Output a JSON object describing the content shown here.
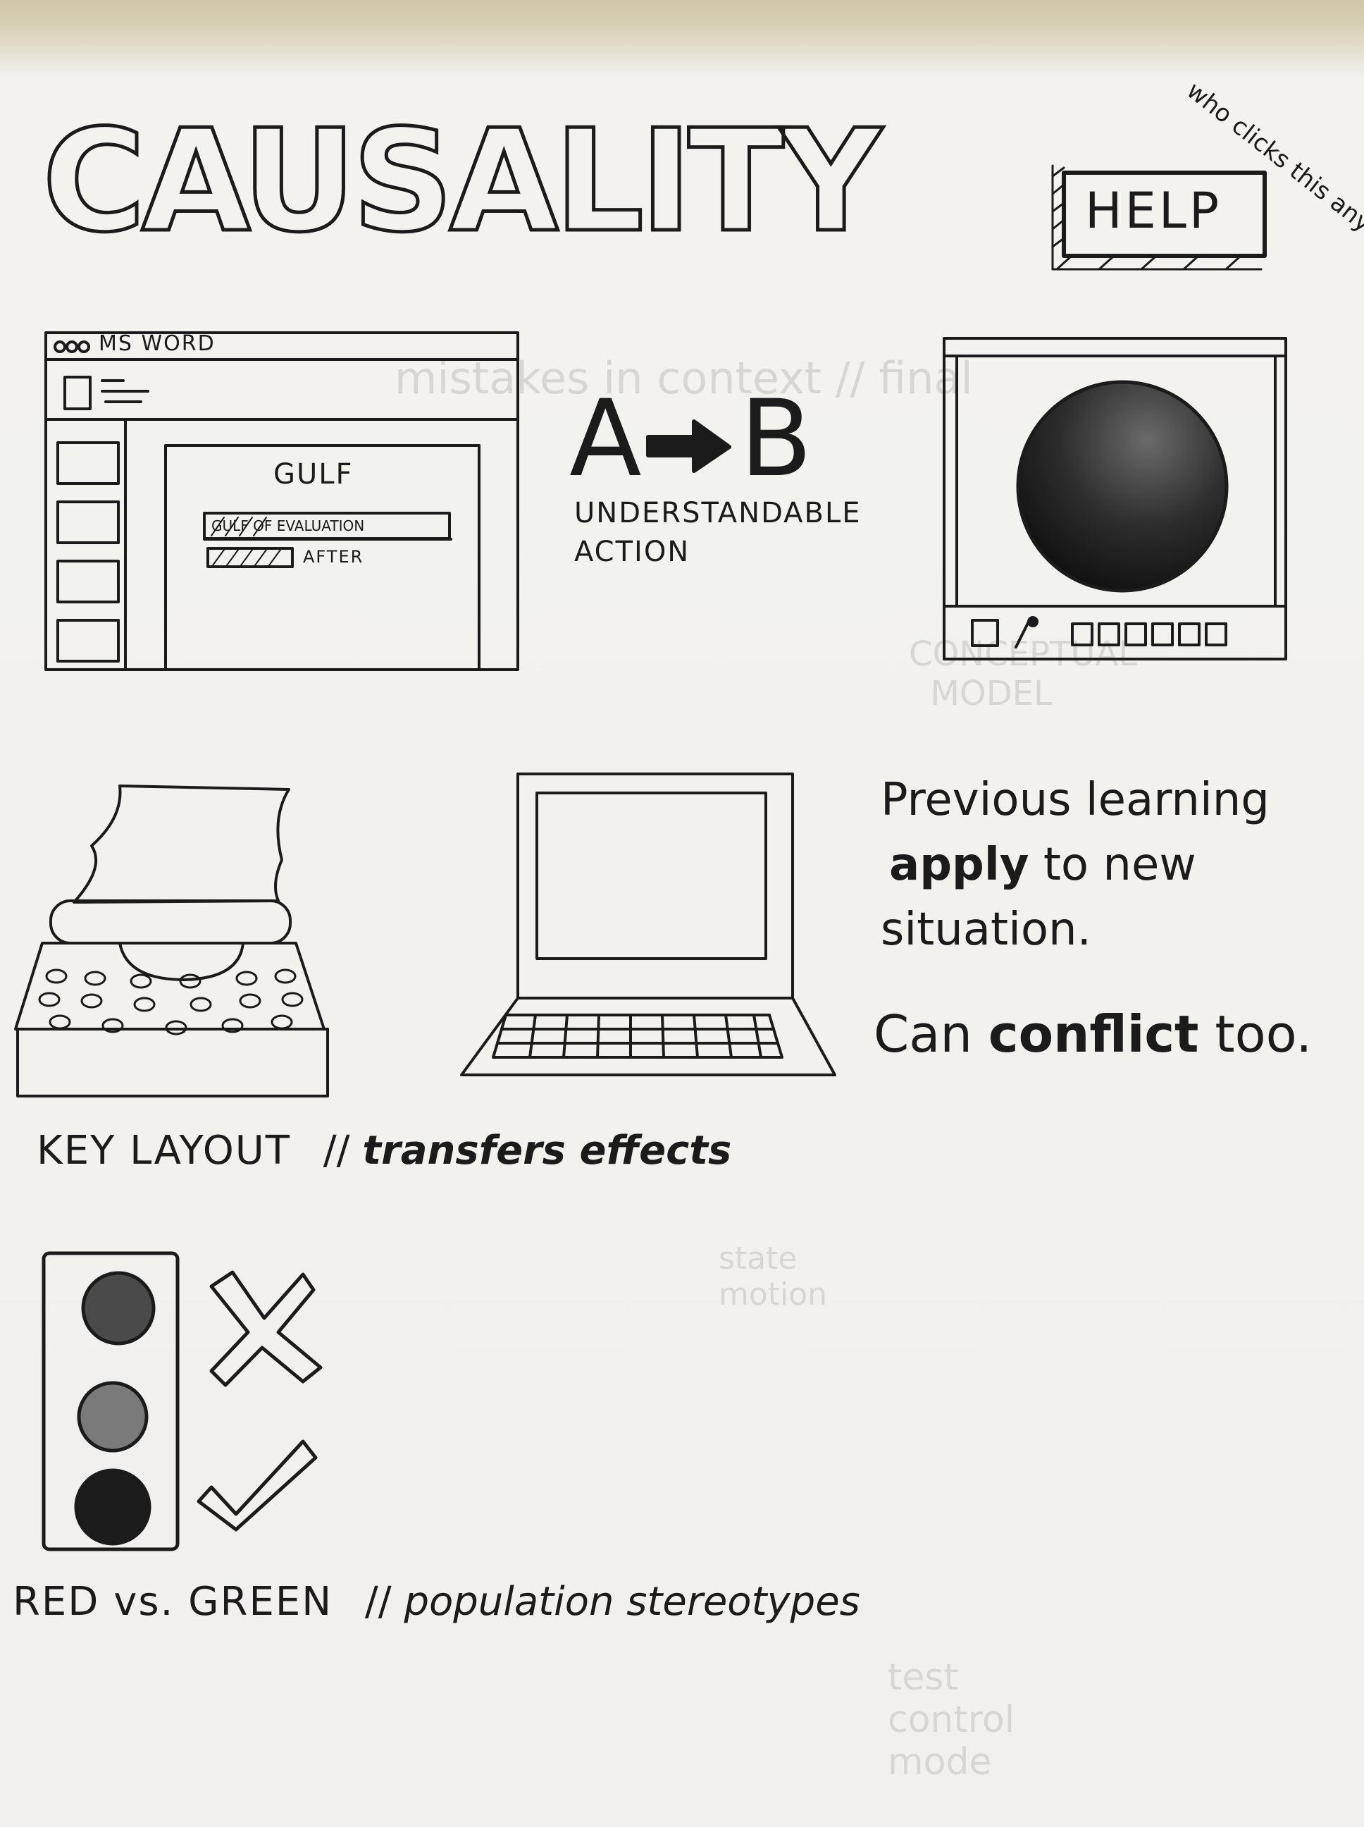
{
  "title": "CAUSALITY",
  "help": {
    "label": "HELP",
    "note": "who clicks this anyways ?"
  },
  "word_window": {
    "title_bar": "MS WORD",
    "doc_heading": "GULF",
    "row1": "GULF OF EVALUATION",
    "row2": "AFTER"
  },
  "arrow_note": {
    "a": "A",
    "b": "B",
    "line1": "UNDERSTANDABLE",
    "line2": "ACTION"
  },
  "learning_note": {
    "line1": "Previous learning",
    "apply": "apply",
    "line2_rest": "to new",
    "line3": "situation.",
    "can": "Can",
    "conflict": "conflict",
    "too": "too."
  },
  "key_layout": {
    "caps": "KEY LAYOUT",
    "sep": "//",
    "rest": "transfers effects"
  },
  "traffic": {
    "caps": "RED vs. GREEN",
    "sep": "//",
    "rest": "population stereotypes"
  },
  "icons": [
    "typewriter-icon",
    "laptop-icon",
    "traffic-light-icon",
    "cross-mark-icon",
    "check-mark-icon",
    "sphere-icon"
  ]
}
